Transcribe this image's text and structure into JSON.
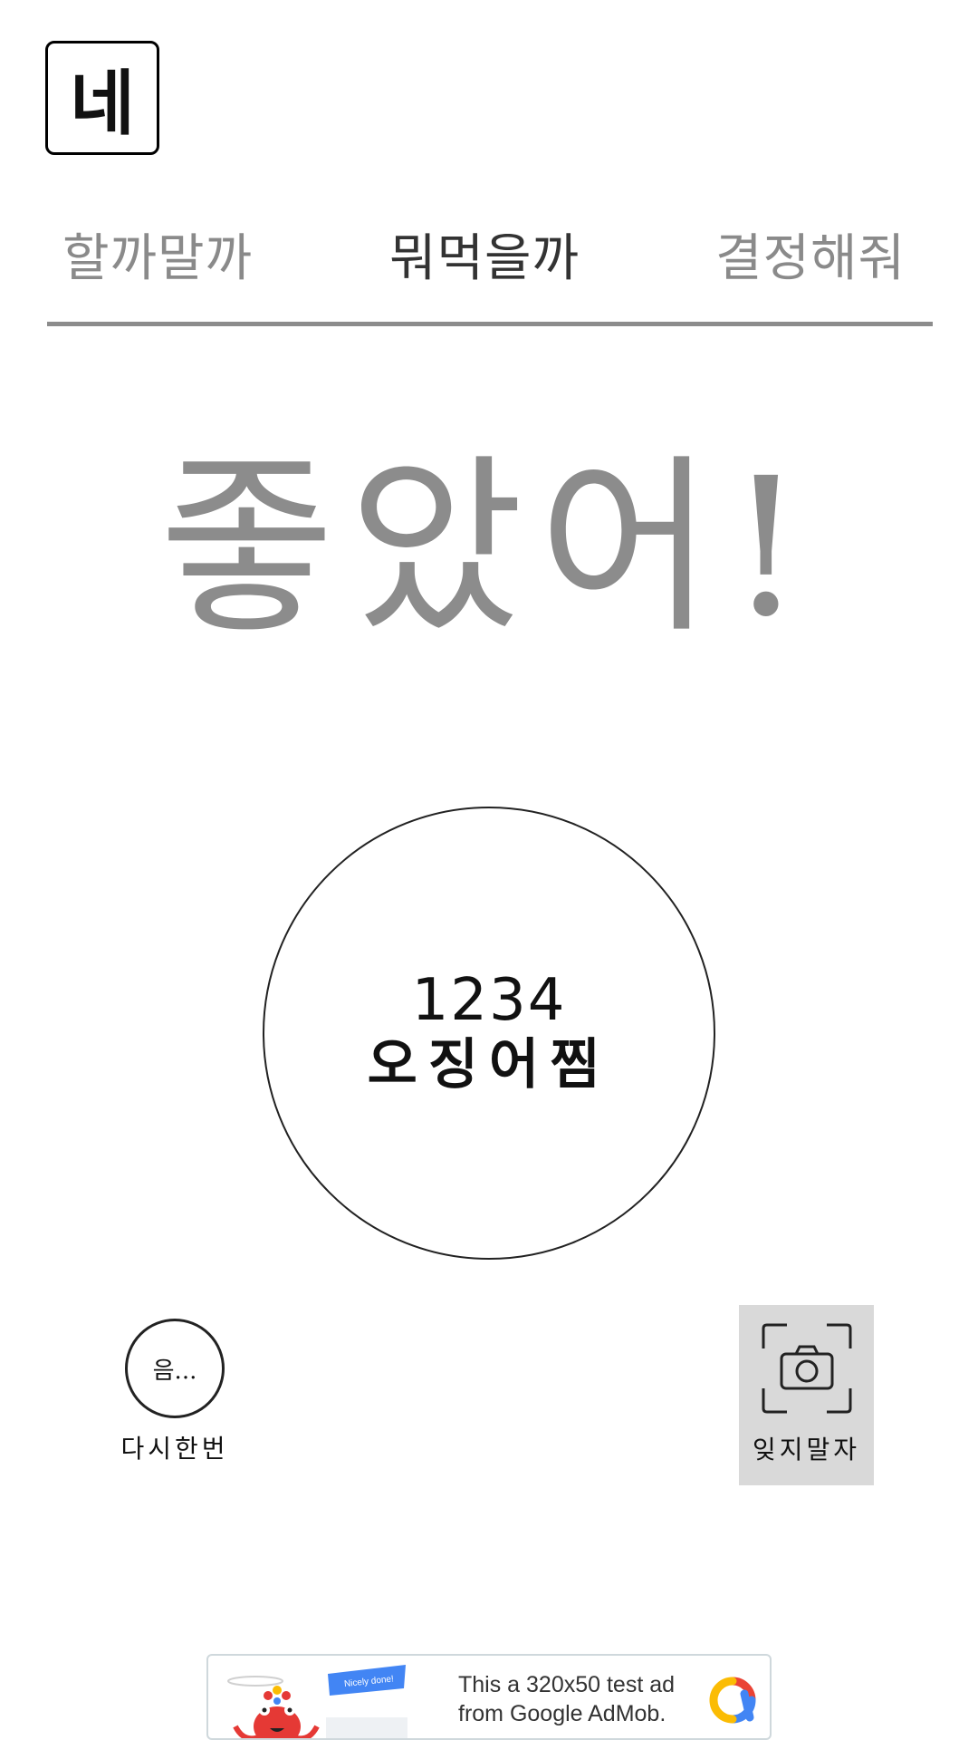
{
  "app": {
    "logo_char": "네"
  },
  "tabs": [
    {
      "label": "할까말까",
      "active": false
    },
    {
      "label": "뭐먹을까",
      "active": true
    },
    {
      "label": "결정해줘",
      "active": false
    }
  ],
  "result": {
    "headline": "좋았어!",
    "number": "1234",
    "name": "오징어찜"
  },
  "actions": {
    "retry_badge": "음...",
    "retry_label": "다시한번",
    "camera_label": "잊지말자"
  },
  "ad": {
    "line1": "This a 320x50 test ad",
    "line2": "from Google AdMob.",
    "banner_text": "Nicely done!"
  },
  "colors": {
    "tab_inactive": "#8a8a8a",
    "tab_active": "#333333",
    "headline": "#8c8c8c",
    "camera_bg": "#d9d9d9"
  },
  "icons": {
    "camera": "camera-icon",
    "ad_logo": "admob-logo-icon"
  }
}
